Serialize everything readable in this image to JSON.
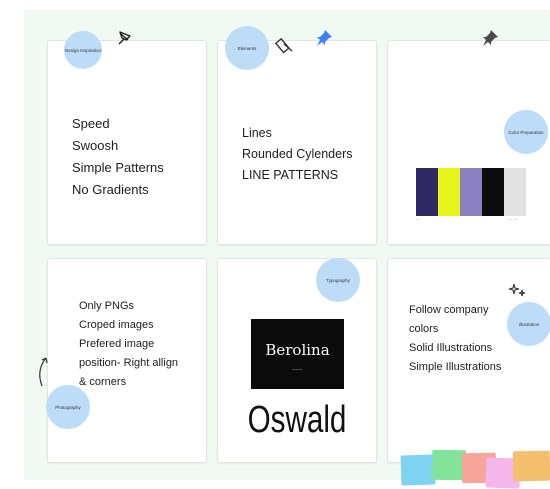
{
  "cards": {
    "design_inspiration": {
      "tag": "Design Inspiration",
      "lines": [
        "Speed",
        "Swoosh",
        "Simple Patterns",
        "No Gradients"
      ]
    },
    "elements": {
      "tag": "Elements",
      "lines": [
        "Lines",
        "Rounded Cylenders",
        "LINE PATTERNS"
      ]
    },
    "color_preparation": {
      "tag": "Color Preparation",
      "swatches": [
        "#2f2a66",
        "#e6f51c",
        "#8b80c2",
        "#0c0c0c",
        "#e1e1e1"
      ],
      "caption_left": "—",
      "caption_right": "— —"
    },
    "photography": {
      "tag": "Photography",
      "lines": [
        "Only PNGs",
        "Croped images",
        "Prefered image",
        "position- Right allign",
        "& corners"
      ]
    },
    "typography": {
      "tag": "Typography",
      "font_sample_1": "Berolina",
      "font_sample_1_sub": "——",
      "font_sample_2": "Oswald"
    },
    "illustration": {
      "tag": "Illustration",
      "lines": [
        "Follow company",
        "colors",
        "Solid Illustrations",
        "Simple Illustrations"
      ]
    }
  },
  "colors": {
    "board_background": "#f1faf2",
    "tag_bubble": "#bcdcf7",
    "pin_blue": "#3b82f6",
    "pin_gray": "#4b4b4b",
    "stickies": [
      "#7fd3f2",
      "#83e39a",
      "#f7a59b",
      "#f5b6ec",
      "#f5c06e"
    ]
  }
}
